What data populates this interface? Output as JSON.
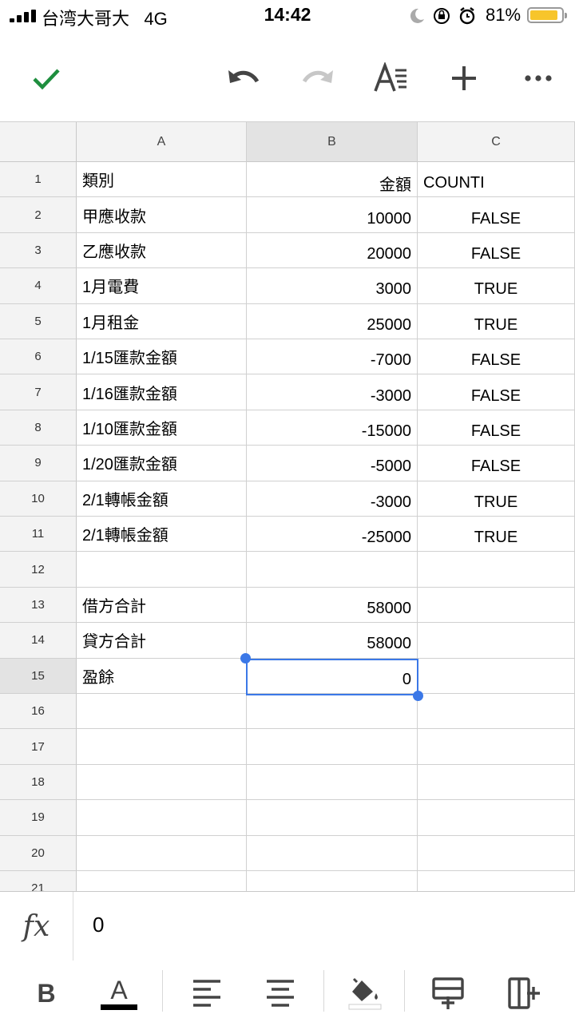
{
  "status_bar": {
    "carrier": "台湾大哥大",
    "network": "4G",
    "time": "14:42",
    "battery_percent": "81%",
    "battery_level": 0.81
  },
  "toolbar": {
    "icons": [
      "check-icon",
      "undo-icon",
      "redo-icon",
      "text-format-icon",
      "add-icon",
      "more-icon"
    ]
  },
  "grid": {
    "columns": [
      "A",
      "B",
      "C"
    ],
    "selected_column": "B",
    "selected_row": "15",
    "rows": [
      {
        "n": "1",
        "a": "類別",
        "b": "金額",
        "c": "COUNTI"
      },
      {
        "n": "2",
        "a": "甲應收款",
        "b": "10000",
        "c": "FALSE"
      },
      {
        "n": "3",
        "a": "乙應收款",
        "b": "20000",
        "c": "FALSE"
      },
      {
        "n": "4",
        "a": "1月電費",
        "b": "3000",
        "c": "TRUE"
      },
      {
        "n": "5",
        "a": "1月租金",
        "b": "25000",
        "c": "TRUE"
      },
      {
        "n": "6",
        "a": "1/15匯款金額",
        "b": "-7000",
        "c": "FALSE"
      },
      {
        "n": "7",
        "a": "1/16匯款金額",
        "b": "-3000",
        "c": "FALSE"
      },
      {
        "n": "8",
        "a": "1/10匯款金額",
        "b": "-15000",
        "c": "FALSE"
      },
      {
        "n": "9",
        "a": "1/20匯款金額",
        "b": "-5000",
        "c": "FALSE"
      },
      {
        "n": "10",
        "a": "2/1轉帳金額",
        "b": "-3000",
        "c": "TRUE"
      },
      {
        "n": "11",
        "a": "2/1轉帳金額",
        "b": "-25000",
        "c": "TRUE"
      },
      {
        "n": "12",
        "a": "",
        "b": "",
        "c": ""
      },
      {
        "n": "13",
        "a": "借方合計",
        "b": "58000",
        "c": ""
      },
      {
        "n": "14",
        "a": "貸方合計",
        "b": "58000",
        "c": ""
      },
      {
        "n": "15",
        "a": "盈餘",
        "b": "0",
        "c": ""
      },
      {
        "n": "16",
        "a": "",
        "b": "",
        "c": ""
      },
      {
        "n": "17",
        "a": "",
        "b": "",
        "c": ""
      },
      {
        "n": "18",
        "a": "",
        "b": "",
        "c": ""
      },
      {
        "n": "19",
        "a": "",
        "b": "",
        "c": ""
      },
      {
        "n": "20",
        "a": "",
        "b": "",
        "c": ""
      },
      {
        "n": "21",
        "a": "",
        "b": "",
        "c": ""
      }
    ]
  },
  "formula_bar": {
    "label": "fx",
    "value": "0"
  },
  "format_bar": {
    "bold_label": "B",
    "text_color_label": "A",
    "icons": [
      "bold-icon",
      "text-color-icon",
      "align-left-icon",
      "align-center-icon",
      "fill-color-icon",
      "insert-row-icon",
      "insert-column-icon"
    ]
  },
  "colors": {
    "accent": "#3b78e7",
    "check": "#1e8e3e",
    "battery": "#f7c52b"
  }
}
